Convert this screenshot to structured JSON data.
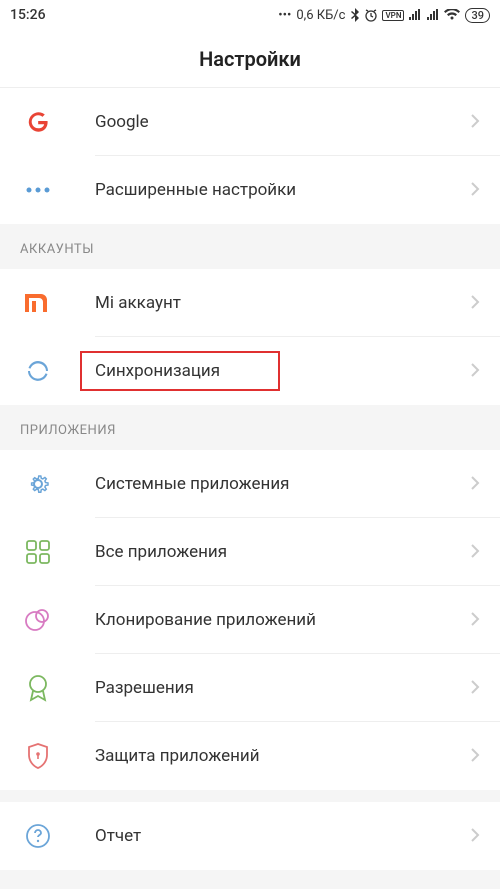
{
  "status": {
    "time": "15:26",
    "speed": "0,6 КБ/с",
    "battery": "39"
  },
  "title": "Настройки",
  "sections": {
    "top": {
      "google": "Google",
      "advanced": "Расширенные настройки"
    },
    "accounts": {
      "header": "АККАУНТЫ",
      "mi": "Mi аккаунт",
      "sync": "Синхронизация"
    },
    "apps": {
      "header": "ПРИЛОЖЕНИЯ",
      "system": "Системные приложения",
      "all": "Все приложения",
      "clone": "Клонирование приложений",
      "permissions": "Разрешения",
      "protection": "Защита приложений"
    },
    "report": {
      "label": "Отчет"
    }
  }
}
